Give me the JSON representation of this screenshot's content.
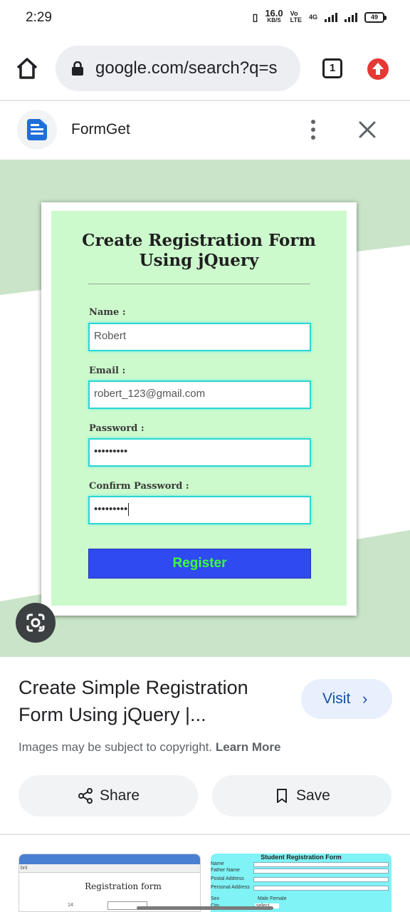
{
  "status_bar": {
    "time": "2:29",
    "speed_value": "16.0",
    "speed_unit": "KB/S",
    "volte_top": "Vo",
    "volte_bottom": "LTE",
    "network": "4G",
    "battery": "49"
  },
  "browser": {
    "url": "google.com/search?q=s",
    "tab_count": "1"
  },
  "source": {
    "name": "FormGet"
  },
  "preview": {
    "form_title_line1": "Create Registration Form",
    "form_title_line2": "Using jQuery",
    "fields": [
      {
        "label": "Name :",
        "value": "Robert"
      },
      {
        "label": "Email :",
        "value": "robert_123@gmail.com"
      },
      {
        "label": "Password :",
        "value": "•••••••••"
      },
      {
        "label": "Confirm Password :",
        "value": "•••••••••"
      }
    ],
    "register_label": "Register"
  },
  "result": {
    "title": "Create Simple Registration Form Using jQuery |...",
    "visit_label": "Visit",
    "copyright_text": "Images may be subject to copyright.",
    "learn_more": "Learn More",
    "share_label": "Share",
    "save_label": "Save"
  },
  "thumbnails": {
    "thumb1_title": "Registration form",
    "thumb1_header": "bnl",
    "thumb1_number": "14",
    "thumb2_title": "Student Registration Form",
    "thumb2_rows": [
      "Name",
      "Father Name",
      "Postal Address",
      "Personal Address",
      "Sex",
      "City"
    ],
    "thumb2_sex_options": "Male  Female",
    "thumb2_select": "select"
  },
  "colors": {
    "accent_blue": "#174ea6",
    "form_bg": "#ccfacc",
    "register_bg": "#2f4af0",
    "register_text": "#3cff3c",
    "update_red": "#e53935"
  }
}
